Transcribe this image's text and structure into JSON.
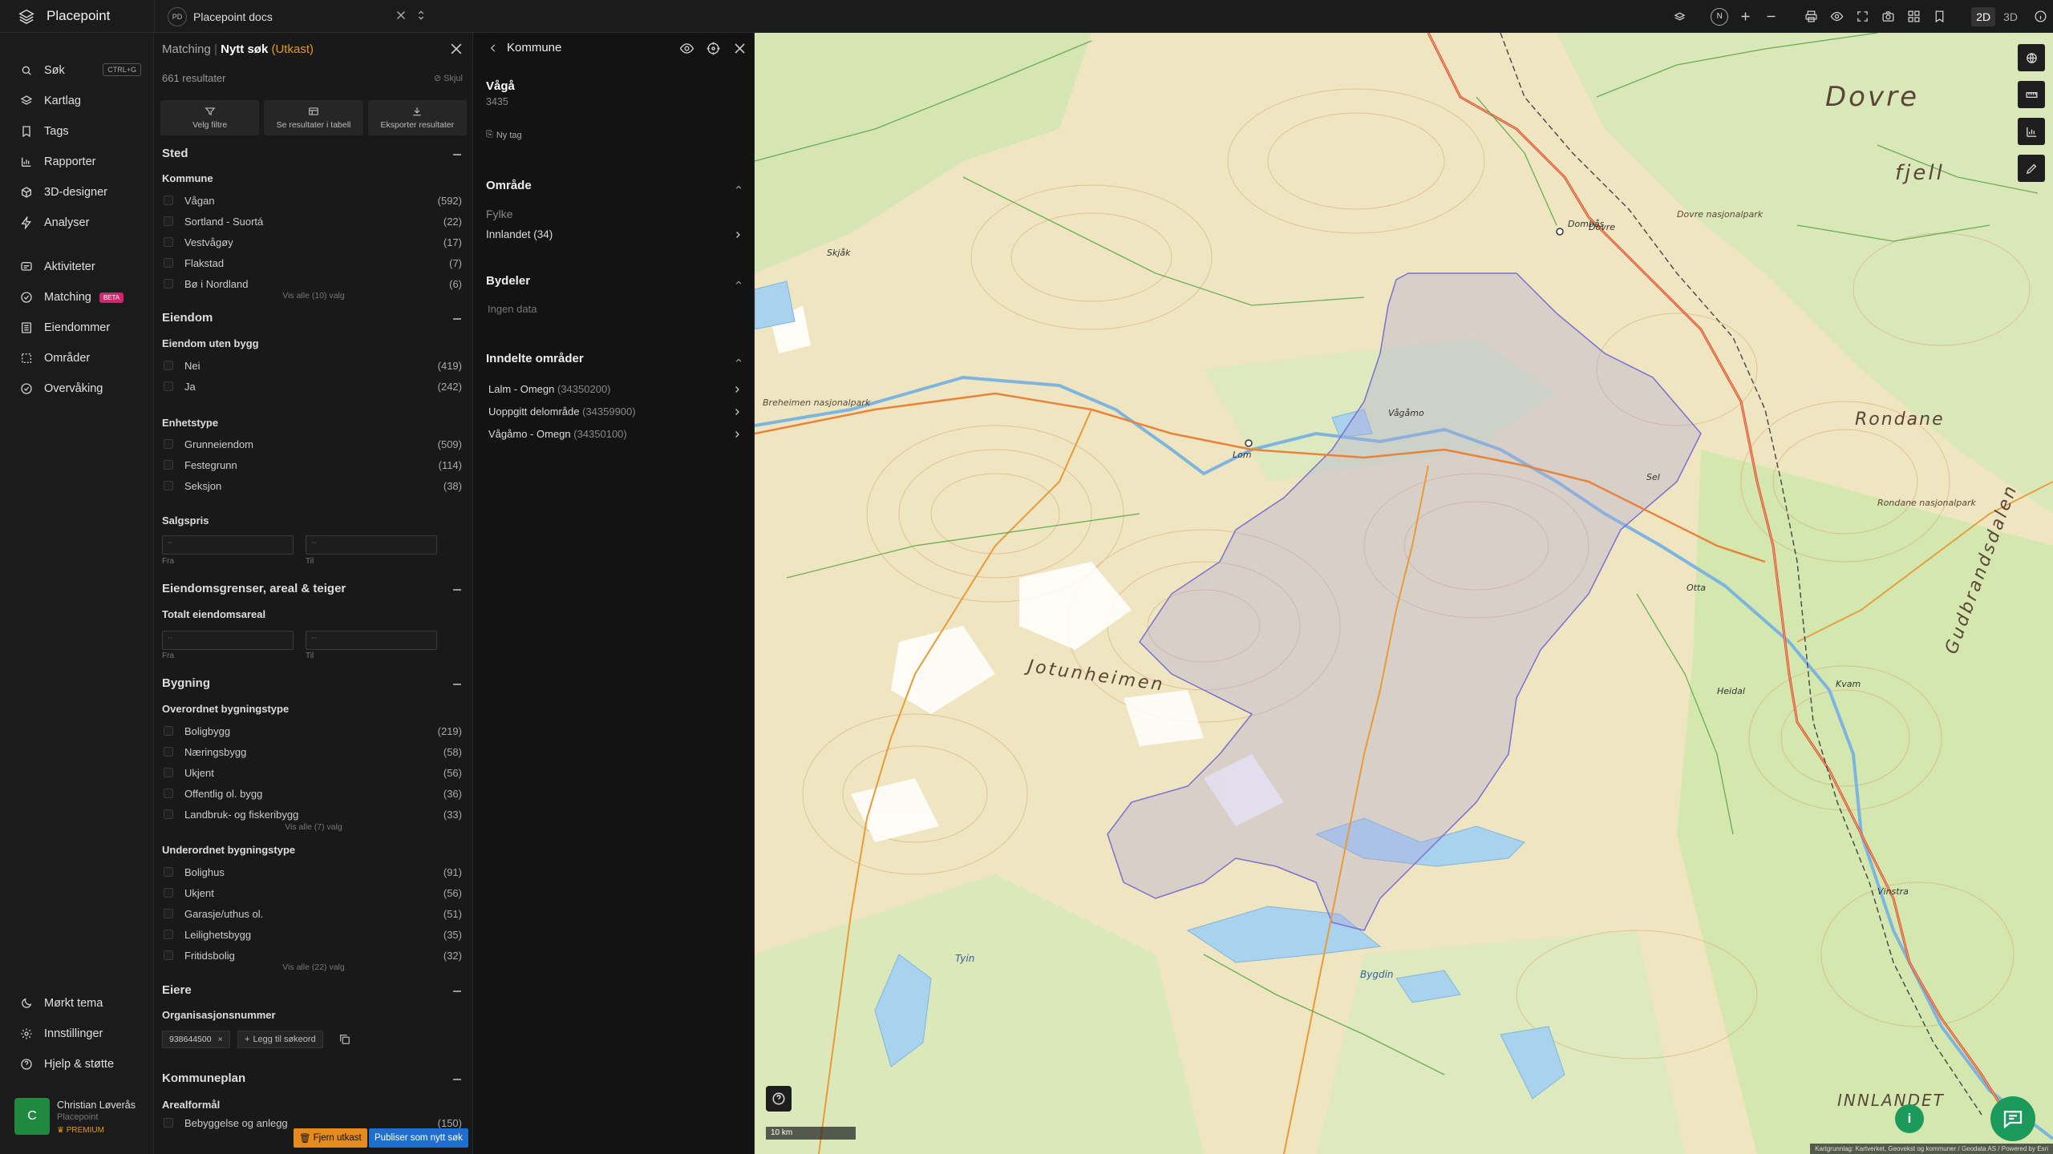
{
  "app": {
    "name": "Placepoint"
  },
  "workspace": {
    "initials": "PD",
    "name": "Placepoint docs"
  },
  "toolbar": {
    "compass": "N",
    "mode_2d": "2D",
    "mode_3d": "3D"
  },
  "nav": {
    "items": [
      {
        "label": "Søk",
        "shortcut": "CTRL+G"
      },
      {
        "label": "Kartlag"
      },
      {
        "label": "Tags"
      },
      {
        "label": "Rapporter"
      },
      {
        "label": "3D-designer"
      },
      {
        "label": "Analyser"
      },
      {
        "label": "Aktiviteter"
      },
      {
        "label": "Matching",
        "badge": "BETA"
      },
      {
        "label": "Eiendommer"
      },
      {
        "label": "Områder"
      },
      {
        "label": "Overvåking"
      }
    ],
    "bottom": [
      {
        "label": "Mørkt tema"
      },
      {
        "label": "Innstillinger"
      },
      {
        "label": "Hjelp & støtte"
      }
    ],
    "user": {
      "initial": "C",
      "name": "Christian Løverås",
      "org": "Placepoint",
      "plan": "PREMIUM"
    }
  },
  "search": {
    "crumb": "Matching",
    "title": "Nytt søk",
    "draft": "(Utkast)",
    "results": "661 resultater",
    "hide": "Skjul",
    "actions": [
      "Velg filtre",
      "Se resultater i tabell",
      "Eksporter resultater"
    ],
    "sted": {
      "title": "Sted",
      "kommune_label": "Kommune",
      "kommune": [
        {
          "name": "Vågan",
          "count": "(592)"
        },
        {
          "name": "Sortland - Suortá",
          "count": "(22)"
        },
        {
          "name": "Vestvågøy",
          "count": "(17)"
        },
        {
          "name": "Flakstad",
          "count": "(7)"
        },
        {
          "name": "Bø i Nordland",
          "count": "(6)"
        }
      ],
      "more": "Vis alle (10) valg"
    },
    "eiendom": {
      "title": "Eiendom",
      "uten_bygg_label": "Eiendom uten bygg",
      "uten_bygg": [
        {
          "name": "Nei",
          "count": "(419)"
        },
        {
          "name": "Ja",
          "count": "(242)"
        }
      ],
      "enhetstype_label": "Enhetstype",
      "enhetstype": [
        {
          "name": "Grunneiendom",
          "count": "(509)"
        },
        {
          "name": "Festegrunn",
          "count": "(114)"
        },
        {
          "name": "Seksjon",
          "count": "(38)"
        }
      ],
      "salgspris_label": "Salgspris",
      "from_label": "Fra",
      "to_label": "Til",
      "range_placeholder": "--"
    },
    "areal": {
      "title": "Eiendomsgrenser, areal & teiger",
      "total_label": "Totalt eiendomsareal"
    },
    "bygning": {
      "title": "Bygning",
      "overordnet_label": "Overordnet bygningstype",
      "overordnet": [
        {
          "name": "Boligbygg",
          "count": "(219)"
        },
        {
          "name": "Næringsbygg",
          "count": "(58)"
        },
        {
          "name": "Ukjent",
          "count": "(56)"
        },
        {
          "name": "Offentlig ol. bygg",
          "count": "(36)"
        },
        {
          "name": "Landbruk- og fiskeribygg",
          "count": "(33)"
        }
      ],
      "overordnet_more": "Vis alle (7) valg",
      "underordnet_label": "Underordnet bygningstype",
      "underordnet": [
        {
          "name": "Bolighus",
          "count": "(91)"
        },
        {
          "name": "Ukjent",
          "count": "(56)"
        },
        {
          "name": "Garasje/uthus ol.",
          "count": "(51)"
        },
        {
          "name": "Leilighetsbygg",
          "count": "(35)"
        },
        {
          "name": "Fritidsbolig",
          "count": "(32)"
        }
      ],
      "underordnet_more": "Vis alle (22) valg"
    },
    "eiere": {
      "title": "Eiere",
      "org_label": "Organisasjonsnummer",
      "chip": "938644500",
      "add": "Legg til søkeord"
    },
    "kommuneplan": {
      "title": "Kommuneplan",
      "areal_label": "Arealformål",
      "first": {
        "name": "Bebyggelse og anlegg",
        "count": "(150)"
      }
    },
    "remove_draft": "Fjern utkast",
    "publish": "Publiser som nytt søk"
  },
  "details": {
    "title": "Kommune",
    "name": "Vågå",
    "code": "3435",
    "tag": "Ny tag",
    "omrade": {
      "title": "Område",
      "fylke_label": "Fylke",
      "fylke": "Innlandet (34)"
    },
    "bydeler": {
      "title": "Bydeler",
      "empty": "Ingen data"
    },
    "inndelte": {
      "title": "Inndelte områder",
      "items": [
        {
          "name": "Lalm - Omegn",
          "code": "(34350200)"
        },
        {
          "name": "Uoppgitt delområde",
          "code": "(34359900)"
        },
        {
          "name": "Vågåmo - Omegn",
          "code": "(34350100)"
        }
      ]
    }
  },
  "map": {
    "scale": "10 km",
    "attribution": "Kartgrunnlag: Kartverket, Geovekst og kommuner / Geodata AS / Powered by Esri",
    "labels": [
      "Dovre",
      "fjell",
      "Rondane",
      "Rondane nasjonalpark",
      "Gudbrandsdalen",
      "Jotunheimen",
      "INNLANDET",
      "Vågåmo",
      "Lom",
      "Otta",
      "Sel",
      "Dombås",
      "Bygdin",
      "Tyin",
      "Breheimen nasjonalpark",
      "Skjåk",
      "Dovre nasjonalpark",
      "Heidal",
      "Vinstra",
      "Dovre",
      "Kvam"
    ]
  }
}
